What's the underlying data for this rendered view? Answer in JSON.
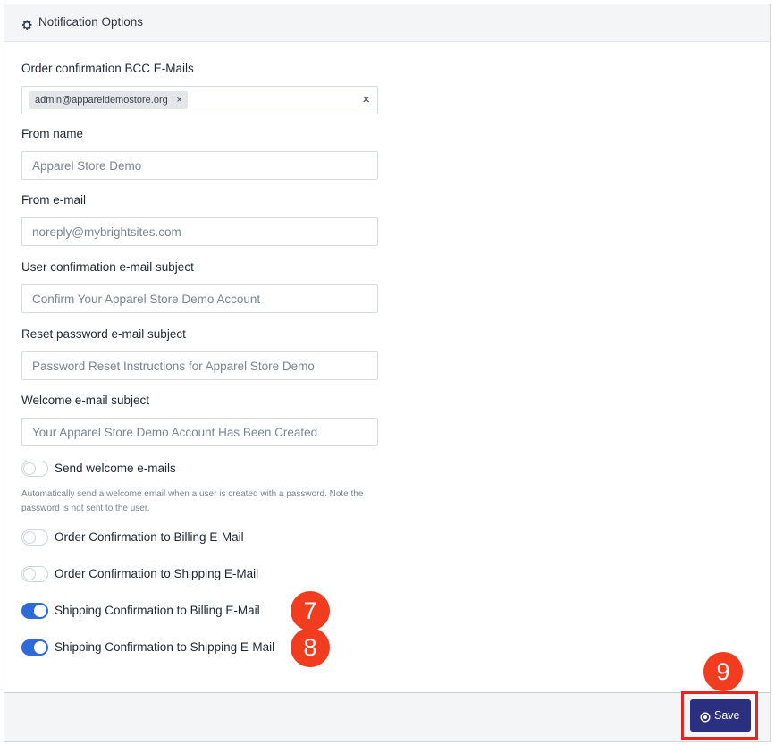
{
  "header": {
    "title": "Notification Options",
    "icon": "gear-icon"
  },
  "bcc": {
    "label": "Order confirmation BCC E-Mails",
    "tags": [
      "admin@appareldemostore.org"
    ],
    "tag_remove": "×",
    "clear": "×"
  },
  "from_name": {
    "label": "From name",
    "value": "Apparel Store Demo"
  },
  "from_email": {
    "label": "From e-mail",
    "value": "noreply@mybrightsites.com"
  },
  "user_confirm": {
    "label": "User confirmation e-mail subject",
    "value": "Confirm Your Apparel Store Demo Account"
  },
  "reset_pw": {
    "label": "Reset password e-mail subject",
    "value": "Password Reset Instructions for Apparel Store Demo"
  },
  "welcome": {
    "label": "Welcome e-mail subject",
    "value": "Your Apparel Store Demo Account Has Been Created"
  },
  "toggles": {
    "send_welcome": {
      "label": "Send welcome e-mails",
      "on": false
    },
    "welcome_help": "Automatically send a welcome email when a user is created with a password. Note the password is not sent to the user.",
    "order_billing": {
      "label": "Order Confirmation to Billing E-Mail",
      "on": false
    },
    "order_shipping": {
      "label": "Order Confirmation to Shipping E-Mail",
      "on": false
    },
    "ship_billing": {
      "label": "Shipping Confirmation to Billing E-Mail",
      "on": true
    },
    "ship_shipping": {
      "label": "Shipping Confirmation to Shipping E-Mail",
      "on": true
    }
  },
  "annotations": {
    "step7": "7",
    "step8": "8",
    "step9": "9"
  },
  "footer": {
    "save_label": "Save"
  },
  "colors": {
    "accent": "#2f6ad9",
    "save_button": "#2a2f7f",
    "annotation": "#f13c20"
  }
}
